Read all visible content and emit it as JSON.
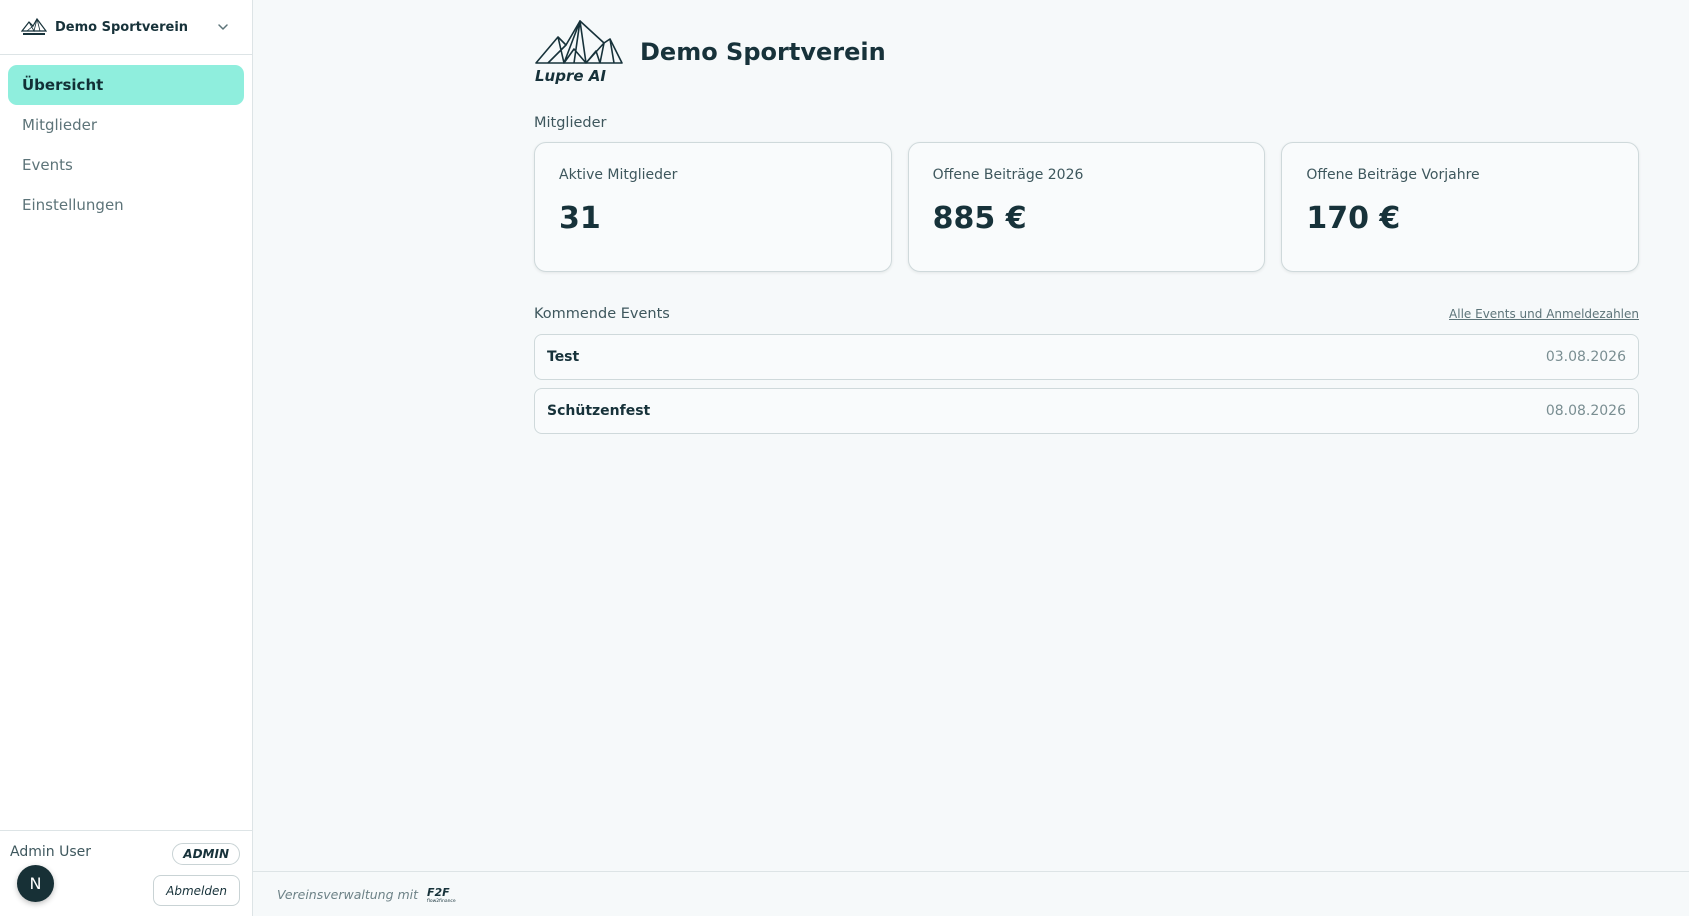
{
  "sidebar": {
    "club_name": "Demo Sportverein",
    "items": [
      {
        "label": "Übersicht",
        "active": true
      },
      {
        "label": "Mitglieder",
        "active": false
      },
      {
        "label": "Events",
        "active": false
      },
      {
        "label": "Einstellungen",
        "active": false
      }
    ],
    "user": {
      "name": "Admin User",
      "role": "ADMIN",
      "avatar_initial": "N",
      "logout_label": "Abmelden"
    }
  },
  "header": {
    "brand": "Lupre AI",
    "title": "Demo Sportverein"
  },
  "members": {
    "section_label": "Mitglieder",
    "stats": [
      {
        "label": "Aktive Mitglieder",
        "value": "31"
      },
      {
        "label": "Offene Beiträge 2026",
        "value": "885 €"
      },
      {
        "label": "Offene Beiträge Vorjahre",
        "value": "170 €"
      }
    ]
  },
  "events": {
    "section_label": "Kommende Events",
    "link_label": "Alle Events und Anmeldezahlen",
    "items": [
      {
        "name": "Test",
        "date": "03.08.2026"
      },
      {
        "name": "Schützenfest",
        "date": "08.08.2026"
      }
    ]
  },
  "footer": {
    "text": "Vereinsverwaltung mit",
    "logo_label": "F2F",
    "logo_sub": "flow2finance"
  },
  "colors": {
    "accent": "#8feedd",
    "dark": "#17323a",
    "background": "#f6f9fa"
  }
}
